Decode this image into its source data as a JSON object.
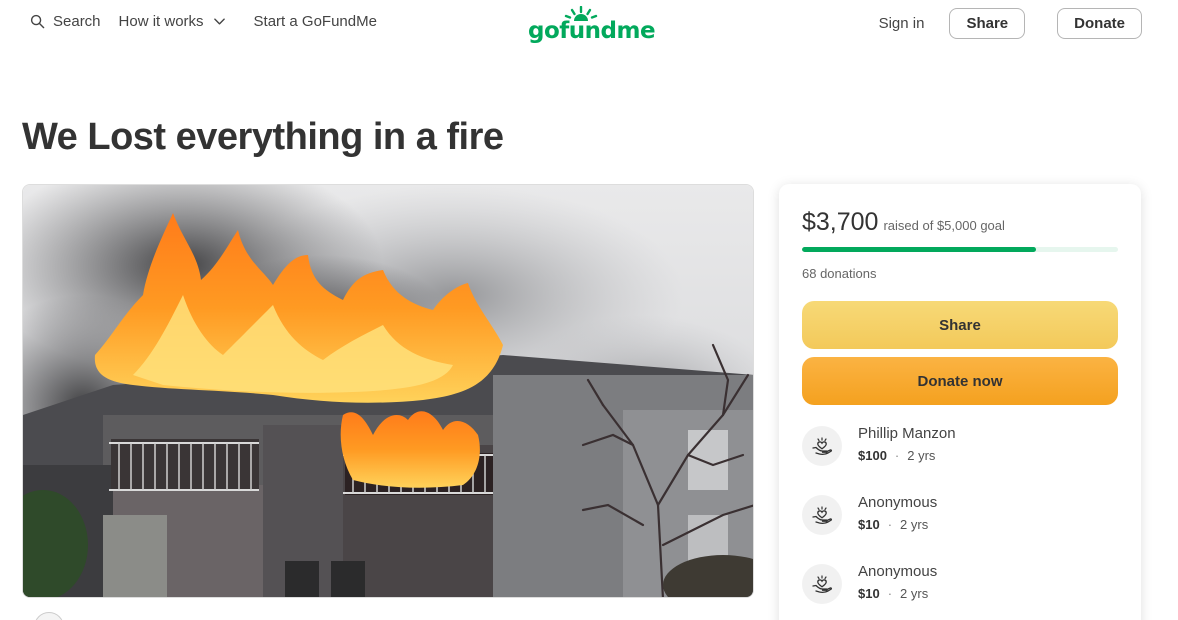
{
  "header": {
    "search_label": "Search",
    "how_it_works_label": "How it works",
    "start_label": "Start a GoFundMe",
    "logo_text": "gofundme",
    "signin_label": "Sign in",
    "share_label": "Share",
    "donate_label": "Donate"
  },
  "campaign": {
    "title": "We Lost everything in a fire",
    "raised_amount": "$3,700",
    "goal_text": "raised of $5,000 goal",
    "progress_fraction": 0.74,
    "donations_count": "68 donations",
    "share_button": "Share",
    "donate_button": "Donate now"
  },
  "donors": [
    {
      "name": "Phillip Manzon",
      "amount": "$100",
      "time": "2 yrs"
    },
    {
      "name": "Anonymous",
      "amount": "$10",
      "time": "2 yrs"
    },
    {
      "name": "Anonymous",
      "amount": "$10",
      "time": "2 yrs"
    }
  ],
  "colors": {
    "brand_green": "#02a95c",
    "share_yellow": "#f3c95a",
    "donate_orange": "#f4a11f"
  },
  "icons": {
    "search": "search-icon",
    "chevron": "chevron-down-icon",
    "donor": "hand-heart-icon"
  }
}
